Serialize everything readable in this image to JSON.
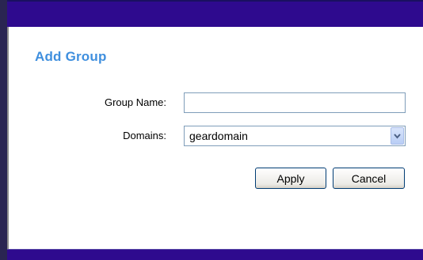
{
  "form": {
    "title": "Add Group",
    "group_name_label": "Group Name:",
    "group_name_value": "",
    "domains_label": "Domains:",
    "domains_selected": "geardomain"
  },
  "buttons": {
    "apply_label": "Apply",
    "cancel_label": "Cancel"
  },
  "colors": {
    "header_bar": "#2e0a8e",
    "title": "#3f8fde"
  },
  "icons": {
    "dropdown": "chevron-down-icon"
  }
}
